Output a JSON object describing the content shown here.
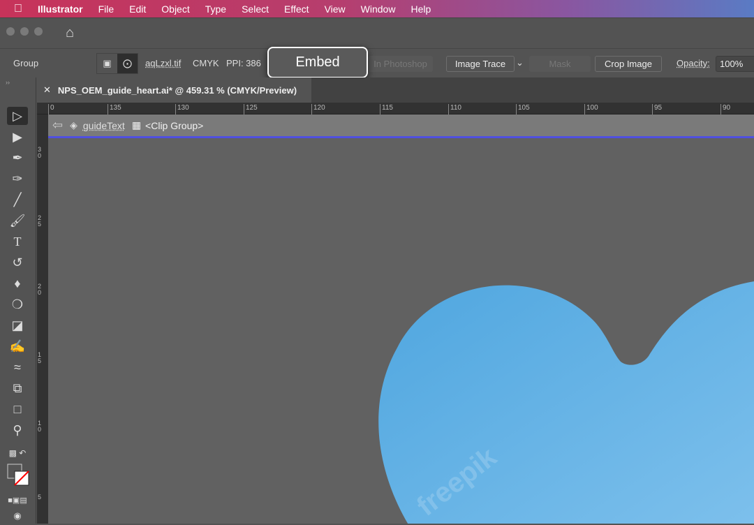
{
  "menubar": {
    "app": "Illustrator",
    "items": [
      "File",
      "Edit",
      "Object",
      "Type",
      "Select",
      "Effect",
      "View",
      "Window",
      "Help"
    ]
  },
  "control": {
    "selection": "Group",
    "filename": "aqLzxl.tif",
    "color_mode": "CMYK",
    "ppi": "PPI: 386",
    "embed": "Embed",
    "edit_photoshop": "In Photoshop",
    "image_trace": "Image Trace",
    "mask": "Mask",
    "crop": "Crop Image",
    "opacity_label": "Opacity:",
    "opacity_value": "100%"
  },
  "document": {
    "tab_title": "NPS_OEM_guide_heart.ai* @ 459.31 % (CMYK/Preview)"
  },
  "ruler": {
    "h": [
      "0",
      "135",
      "130",
      "125",
      "120",
      "115",
      "110",
      "105",
      "100",
      "95",
      "90"
    ],
    "v": [
      "3 0",
      "2 5",
      "2 0",
      "1 5",
      "1 0",
      "5"
    ]
  },
  "isolation": {
    "layer": "guideText",
    "group": "<Clip Group>"
  },
  "artwork": {
    "watermark": "freepik",
    "fill": "#5aaee3"
  }
}
